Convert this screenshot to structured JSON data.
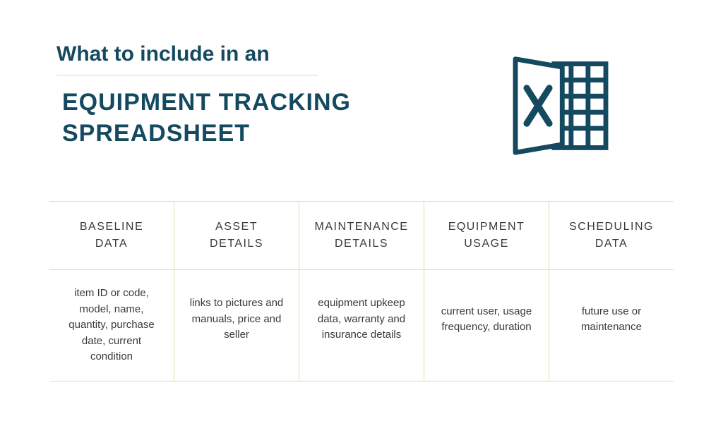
{
  "header": {
    "pretitle": "What to include in an",
    "title": "EQUIPMENT TRACKING SPREADSHEET"
  },
  "columns": [
    {
      "header": "BASELINE\nDATA",
      "body": "item ID or code, model, name, quantity, purchase date, current condition"
    },
    {
      "header": "ASSET\nDETAILS",
      "body": "links to pictures and manuals, price and seller"
    },
    {
      "header": "MAINTENANCE\nDETAILS",
      "body": "equipment upkeep data, warranty and insurance details"
    },
    {
      "header": "EQUIPMENT\nUSAGE",
      "body": "current user, usage frequency, duration"
    },
    {
      "header": "SCHEDULING\nDATA",
      "body": "future use or maintenance"
    }
  ]
}
